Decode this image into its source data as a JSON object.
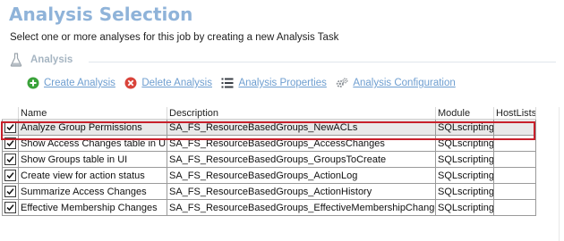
{
  "header": {
    "title": "Analysis Selection",
    "subtitle": "Select one or more analyses for this job by creating a new Analysis Task"
  },
  "section": {
    "label": "Analysis",
    "icon": "flask-icon"
  },
  "toolbar": {
    "create_label": "Create Analysis",
    "delete_label": "Delete Analysis",
    "properties_label": "Analysis Properties",
    "configuration_label": "Analysis Configuration"
  },
  "table": {
    "columns": [
      "",
      "Name",
      "Description",
      "Module",
      "HostLists"
    ],
    "rows": [
      {
        "checked": true,
        "name": "Analyze Group Permissions",
        "description": "SA_FS_ResourceBasedGroups_NewACLs",
        "module": "SQLscripting",
        "hostlists": ""
      },
      {
        "checked": true,
        "name": "Show Access Changes table in UI",
        "description": "SA_FS_ResourceBasedGroups_AccessChanges",
        "module": "SQLscripting",
        "hostlists": ""
      },
      {
        "checked": true,
        "name": "Show Groups table in UI",
        "description": "SA_FS_ResourceBasedGroups_GroupsToCreate",
        "module": "SQLscripting",
        "hostlists": ""
      },
      {
        "checked": true,
        "name": "Create view for action status",
        "description": "SA_FS_ResourceBasedGroups_ActionLog",
        "module": "SQLscripting",
        "hostlists": ""
      },
      {
        "checked": true,
        "name": "Summarize Access Changes",
        "description": "SA_FS_ResourceBasedGroups_ActionHistory",
        "module": "SQLscripting",
        "hostlists": ""
      },
      {
        "checked": true,
        "name": "Effective Membership Changes",
        "description": "SA_FS_ResourceBasedGroups_EffectiveMembershipChanges",
        "module": "SQLscripting",
        "hostlists": ""
      }
    ]
  },
  "colors": {
    "title": "#8fb3d9",
    "link": "#6e9ed0",
    "create_icon": "#3aa23a",
    "delete_icon": "#d9433a",
    "highlight": "#c8202b"
  }
}
